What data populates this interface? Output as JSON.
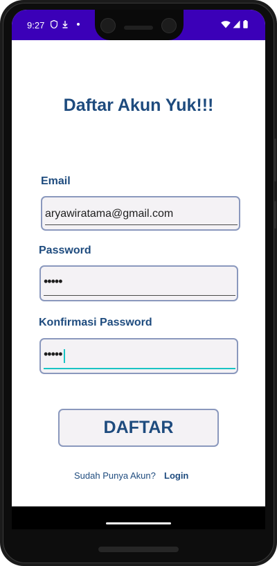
{
  "status_bar": {
    "time": "9:27",
    "background": "#3b00b8",
    "left_icons": [
      "shield-icon",
      "download-icon",
      "dot-icon"
    ],
    "right_icons": [
      "wifi-icon",
      "signal-icon",
      "battery-icon"
    ]
  },
  "page": {
    "title": "Daftar Akun Yuk!!!"
  },
  "form": {
    "email_label": "Email",
    "email_value": "aryawiratama@gmail.com",
    "password_label": "Password",
    "password_value": "•••••",
    "confirm_label": "Konfirmasi Password",
    "confirm_value": "•••••",
    "submit_label": "DAFTAR"
  },
  "footer": {
    "prompt": "Sudah Punya Akun?",
    "login_link": "Login"
  },
  "colors": {
    "accent": "#1e4b7e",
    "field_border": "#8a98bd",
    "field_bg": "#f4f2f5",
    "focus": "#19c4c4"
  }
}
